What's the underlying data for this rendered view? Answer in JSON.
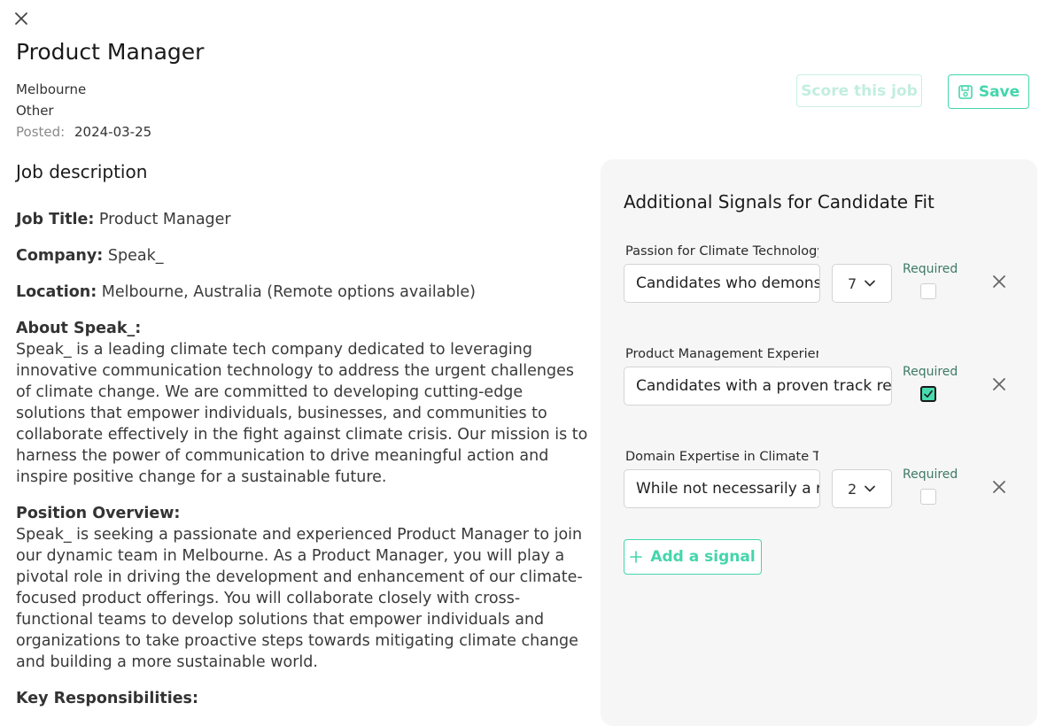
{
  "job": {
    "title": "Product Manager",
    "location": "Melbourne",
    "type": "Other",
    "posted_label": "Posted:",
    "posted_date": "2024-03-25"
  },
  "actions": {
    "score_label": "Score this job",
    "save_label": "Save"
  },
  "description": {
    "heading": "Job description",
    "job_title_label": "Job Title:",
    "job_title_value": " Product Manager",
    "company_label": "Company:",
    "company_value": " Speak_",
    "location_label": "Location:",
    "location_value": " Melbourne, Australia (Remote options available)",
    "about_label": "About Speak_:",
    "about_text": "Speak_ is a leading climate tech company dedicated to leveraging innovative communication technology to address the urgent challenges of climate change. We are committed to developing cutting-edge solutions that empower individuals, businesses, and communities to collaborate effectively in the fight against climate crisis. Our mission is to harness the power of communication to drive meaningful action and inspire positive change for a sustainable future.",
    "overview_label": "Position Overview:",
    "overview_text": "Speak_ is seeking a passionate and experienced Product Manager to join our dynamic team in Melbourne. As a Product Manager, you will play a pivotal role in driving the development and enhancement of our climate-focused product offerings. You will collaborate closely with cross-functional teams to develop solutions that empower individuals and organizations to take proactive steps towards mitigating climate change and building a more sustainable world.",
    "responsibilities_label": "Key Responsibilities:"
  },
  "signals_panel": {
    "heading": "Additional Signals for Candidate Fit",
    "required_label": "Required",
    "add_label": "Add a signal",
    "signals": [
      {
        "label": "Passion for Climate Technology a",
        "value": "Candidates who demons",
        "weight": "7",
        "required": false
      },
      {
        "label": "Product Management Experience",
        "value": "Candidates with a proven track reco",
        "weight": "",
        "required": true
      },
      {
        "label": "Domain Expertise in Climate Tech",
        "value": "While not necessarily a r",
        "weight": "2",
        "required": false
      }
    ]
  },
  "colors": {
    "accent": "#43d6ab",
    "accent_disabled": "#c2eedf",
    "panel_bg": "#f6f6f6",
    "required_text": "#3d7a66"
  },
  "icons": {
    "close": "close-icon",
    "save": "floppy-disk-icon",
    "dropdown": "chevron-down-icon",
    "remove": "close-icon",
    "add": "plus-icon",
    "check": "checkmark-icon"
  }
}
